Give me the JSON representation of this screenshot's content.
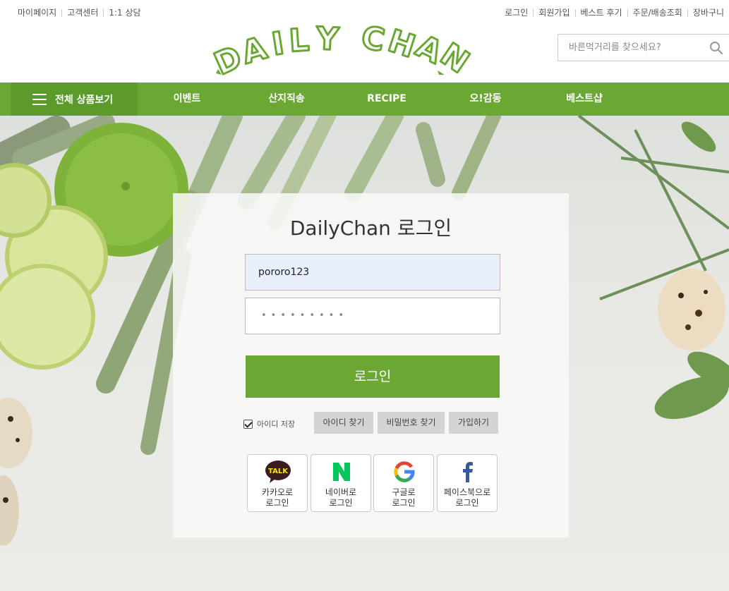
{
  "top_left_links": [
    "마이페이지",
    "고객센터",
    "1:1 상담"
  ],
  "top_right_links": [
    "로그인",
    "회원가입",
    "베스트 후기",
    "주문/배송조회",
    "장바구니"
  ],
  "logo_text": "DAILY CHAN",
  "search": {
    "placeholder": "바른먹거리를 찾으세요?"
  },
  "nav": {
    "all_products": "전체 상품보기",
    "items": [
      "이벤트",
      "산지직송",
      "RECIPE",
      "오!감동",
      "베스트샵"
    ]
  },
  "login": {
    "title": "DailyChan 로그인",
    "id_value": "pororo123",
    "password_mask": "•••••••••",
    "login_button": "로그인",
    "save_id_label": "아이디 저장",
    "find_id": "아이디 찾기",
    "find_pw": "비밀번호 찾기",
    "signup": "가입하기"
  },
  "sns": [
    {
      "icon": "kakao-talk-icon",
      "line1": "카카오로",
      "line2": "로그인"
    },
    {
      "icon": "naver-icon",
      "line1": "네이버로",
      "line2": "로그인"
    },
    {
      "icon": "google-icon",
      "line1": "구글로",
      "line2": "로그인"
    },
    {
      "icon": "facebook-icon",
      "line1": "페이스북으로",
      "line2": "로그인"
    }
  ],
  "colors": {
    "brand_green": "#6aa833",
    "nav_dark": "#5b9a2b",
    "input_autofill": "#e8f0fe"
  }
}
